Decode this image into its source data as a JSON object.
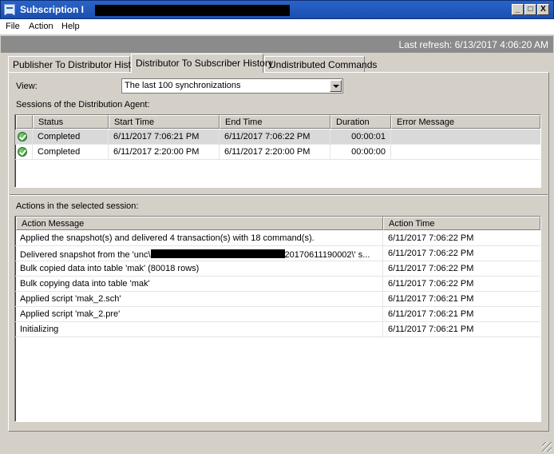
{
  "window": {
    "title": "Subscription I",
    "controls": {
      "minimize": "_",
      "maximize": "□",
      "close": "X"
    }
  },
  "menu": [
    "File",
    "Action",
    "Help"
  ],
  "refresh": "Last refresh: 6/13/2017 4:06:20 AM",
  "tabs": [
    {
      "label": "Publisher To Distributor History",
      "active": false
    },
    {
      "label": "Distributor To Subscriber History",
      "active": true
    },
    {
      "label": "Undistributed Commands",
      "active": false
    }
  ],
  "view": {
    "label": "View:",
    "selected": "The last 100 synchronizations"
  },
  "sessions": {
    "label": "Sessions of the Distribution Agent:",
    "columns": [
      "Status",
      "Start Time",
      "End Time",
      "Duration",
      "Error Message"
    ],
    "rows": [
      {
        "status_icon": "check-circle-icon",
        "status": "Completed",
        "start": "6/11/2017 7:06:21 PM",
        "end": "6/11/2017 7:06:22 PM",
        "duration": "00:00:01",
        "error": "",
        "selected": true
      },
      {
        "status_icon": "check-circle-icon",
        "status": "Completed",
        "start": "6/11/2017 2:20:00 PM",
        "end": "6/11/2017 2:20:00 PM",
        "duration": "00:00:00",
        "error": "",
        "selected": false
      }
    ]
  },
  "actions": {
    "label": "Actions in the selected session:",
    "columns": [
      "Action Message",
      "Action Time"
    ],
    "rows": [
      {
        "message": "Applied the snapshot(s) and delivered 4 transaction(s) with 18 command(s).",
        "time": "6/11/2017 7:06:22 PM"
      },
      {
        "message": "Delivered snapshot from the 'unc\\",
        "message_end": "20170611190002\\' s...",
        "time": "6/11/2017 7:06:22 PM"
      },
      {
        "message": "Bulk copied data into table 'mak' (80018 rows)",
        "time": "6/11/2017 7:06:22 PM"
      },
      {
        "message": "Bulk copying data into table 'mak'",
        "time": "6/11/2017 7:06:22 PM"
      },
      {
        "message": "Applied script 'mak_2.sch'",
        "time": "6/11/2017 7:06:21 PM"
      },
      {
        "message": "Applied script 'mak_2.pre'",
        "time": "6/11/2017 7:06:21 PM"
      },
      {
        "message": "Initializing",
        "time": "6/11/2017 7:06:21 PM"
      }
    ]
  },
  "colors": {
    "title_bar": "#1f56bd",
    "refresh_bar": "#8b8b8b",
    "selected_row": "#d9d9d9",
    "window_bg": "#d4d0c8"
  }
}
